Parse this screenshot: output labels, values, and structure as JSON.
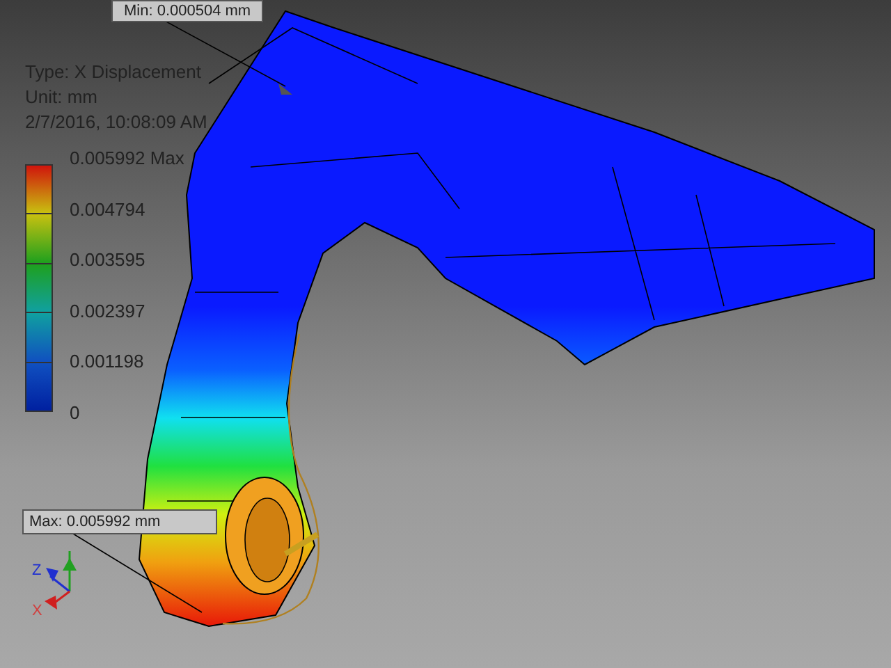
{
  "min_probe": {
    "label": "Min: 0.000504 mm"
  },
  "legend": {
    "type": "Type: X Displacement",
    "unit": "Unit: mm",
    "timestamp": "2/7/2016, 10:08:09 AM",
    "ticks": [
      "0.005992 Max",
      "0.004794",
      "0.003595",
      "0.002397",
      "0.001198",
      "0"
    ]
  },
  "max_probe": {
    "label": "Max: 0.005992 mm"
  },
  "triad": {
    "z": "Z",
    "x": "X"
  }
}
